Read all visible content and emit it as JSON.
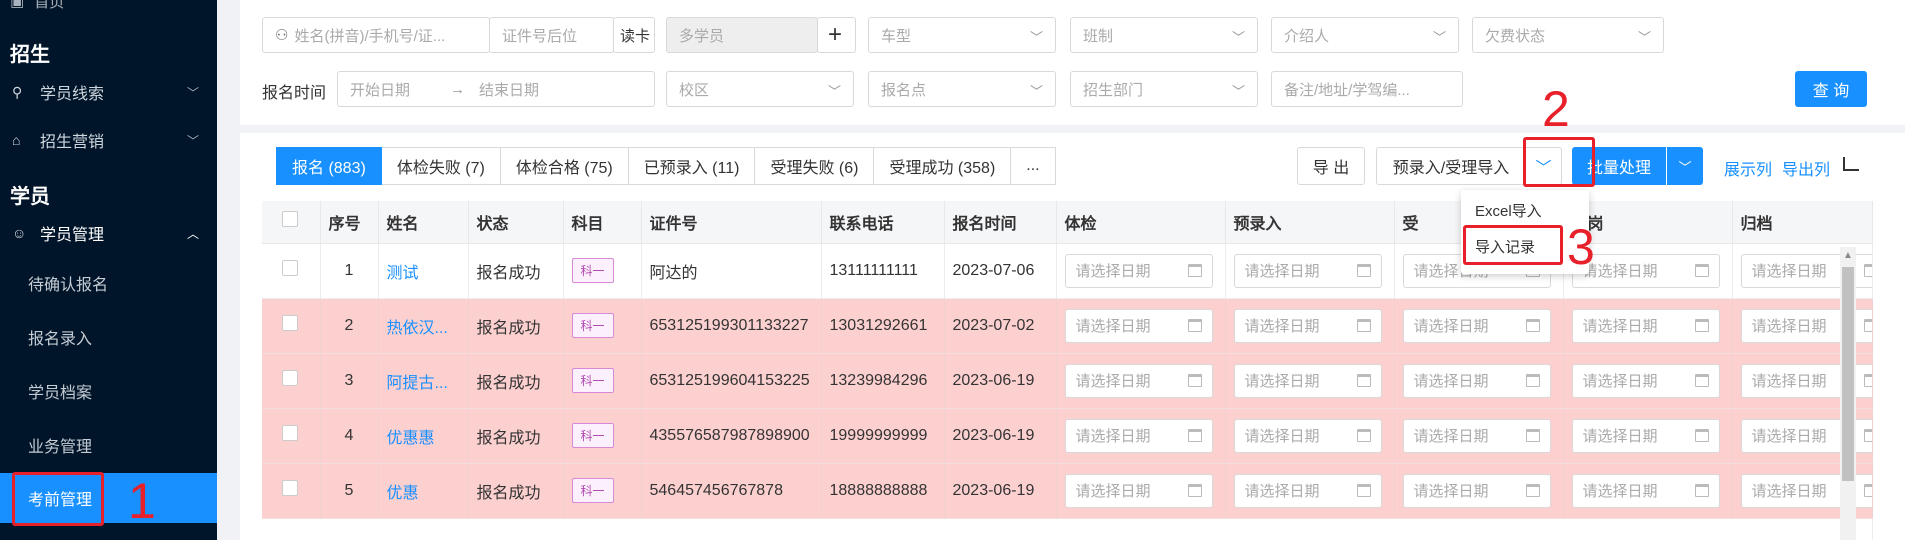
{
  "sidebar": {
    "home": "首页",
    "section_recruit": "招生",
    "recruit_items": [
      "学员线索",
      "招生营销"
    ],
    "section_student": "学员",
    "student_mgmt": "学员管理",
    "sub_items": [
      "待确认报名",
      "报名录入",
      "学员档案",
      "业务管理",
      "考前管理"
    ]
  },
  "filters": {
    "name_placeholder": "姓名(拼音)/手机号/证...",
    "idsuffix_placeholder": "证件号后位",
    "read_card": "读卡",
    "multi_student": "多学员",
    "vehicle": "车型",
    "class_type": "班制",
    "referrer": "介绍人",
    "arrears": "欠费状态",
    "reg_time_label": "报名时间",
    "start_date": "开始日期",
    "end_date": "结束日期",
    "campus": "校区",
    "reg_point": "报名点",
    "dept": "招生部门",
    "note": "备注/地址/学驾编...",
    "query": "查 询"
  },
  "tabs": [
    "报名 (883)",
    "体检失败 (7)",
    "体检合格 (75)",
    "已预录入 (11)",
    "受理失败 (6)",
    "受理成功 (358)",
    "..."
  ],
  "toolbar": {
    "export": "导 出",
    "import": "预录入/受理导入",
    "batch": "批量处理",
    "show_cols": "展示列",
    "export_cols": "导出列"
  },
  "dropdown": [
    "Excel导入",
    "导入记录"
  ],
  "annotations": [
    "1",
    "2",
    "3"
  ],
  "table": {
    "headers": [
      "序号",
      "姓名",
      "状态",
      "科目",
      "证件号",
      "联系电话",
      "报名时间",
      "体检",
      "预录入",
      "受",
      "站岗",
      "归档"
    ],
    "date_placeholder": "请选择日期",
    "rows": [
      {
        "no": "1",
        "name": "测试",
        "status": "报名成功",
        "subject": "科一",
        "id": "阿达的",
        "phone": "13111111111",
        "date": "2023-07-06"
      },
      {
        "no": "2",
        "name": "热依汉...",
        "status": "报名成功",
        "subject": "科一",
        "id": "653125199301133227",
        "phone": "13031292661",
        "date": "2023-07-02"
      },
      {
        "no": "3",
        "name": "阿提古...",
        "status": "报名成功",
        "subject": "科一",
        "id": "653125199604153225",
        "phone": "13239984296",
        "date": "2023-06-19"
      },
      {
        "no": "4",
        "name": "优惠惠",
        "status": "报名成功",
        "subject": "科一",
        "id": "435576587987898900",
        "phone": "19999999999",
        "date": "2023-06-19"
      },
      {
        "no": "5",
        "name": "优惠",
        "status": "报名成功",
        "subject": "科一",
        "id": "546457456767878",
        "phone": "18888888888",
        "date": "2023-06-19"
      }
    ]
  }
}
